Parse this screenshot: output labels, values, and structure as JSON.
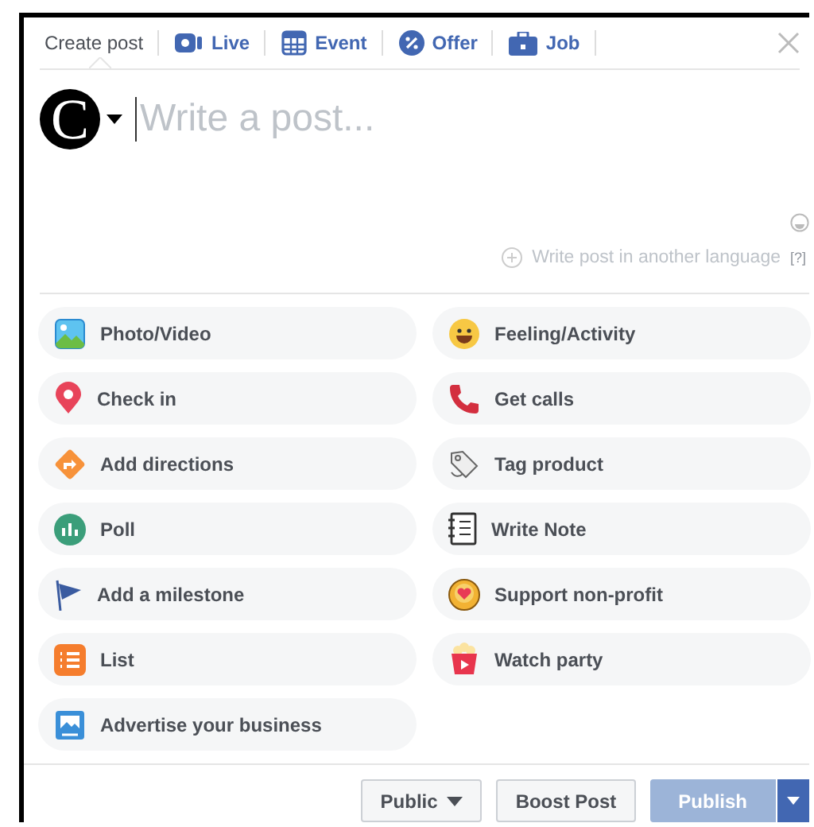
{
  "tabs": [
    {
      "label": "Create post",
      "kind": "text",
      "selected": true
    },
    {
      "label": "Live",
      "kind": "live",
      "selected": false
    },
    {
      "label": "Event",
      "kind": "event",
      "selected": false
    },
    {
      "label": "Offer",
      "kind": "offer",
      "selected": false
    },
    {
      "label": "Job",
      "kind": "job",
      "selected": false
    }
  ],
  "composer": {
    "avatar_letter": "C",
    "placeholder": "Write a post...",
    "translate_link": "Write post in another language",
    "help": "[?]"
  },
  "options": [
    {
      "label": "Photo/Video",
      "kind": "photo"
    },
    {
      "label": "Feeling/Activity",
      "kind": "feeling"
    },
    {
      "label": "Check in",
      "kind": "pin"
    },
    {
      "label": "Get calls",
      "kind": "phone"
    },
    {
      "label": "Add directions",
      "kind": "directions"
    },
    {
      "label": "Tag product",
      "kind": "tag"
    },
    {
      "label": "Poll",
      "kind": "poll"
    },
    {
      "label": "Write Note",
      "kind": "note"
    },
    {
      "label": "Add a milestone",
      "kind": "flag"
    },
    {
      "label": "Support non-profit",
      "kind": "heart"
    },
    {
      "label": "List",
      "kind": "list"
    },
    {
      "label": "Watch party",
      "kind": "popcorn"
    },
    {
      "label": "Advertise your business",
      "kind": "ad"
    }
  ],
  "footer": {
    "audience": "Public",
    "boost": "Boost Post",
    "publish": {
      "label": "Publish",
      "disabled": true
    }
  }
}
